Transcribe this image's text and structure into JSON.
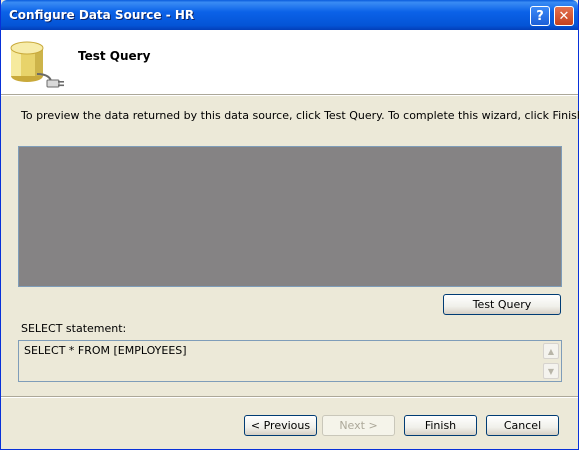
{
  "window": {
    "title": "Configure Data Source - HR",
    "help_label": "?",
    "close_label": "✕"
  },
  "header": {
    "title": "Test Query",
    "icon": "database-plug-icon"
  },
  "body": {
    "instruction": "To preview the data returned by this data source, click Test Query. To complete this wizard, click Finish.",
    "test_query_button": "Test Query",
    "select_label": "SELECT statement:",
    "select_statement": "SELECT * FROM [EMPLOYEES]"
  },
  "footer": {
    "previous": "< Previous",
    "next": "Next >",
    "finish": "Finish",
    "cancel": "Cancel"
  },
  "colors": {
    "titlebar": "#0454d6",
    "results_background": "#858384",
    "dialog_background": "#ece9d8"
  }
}
